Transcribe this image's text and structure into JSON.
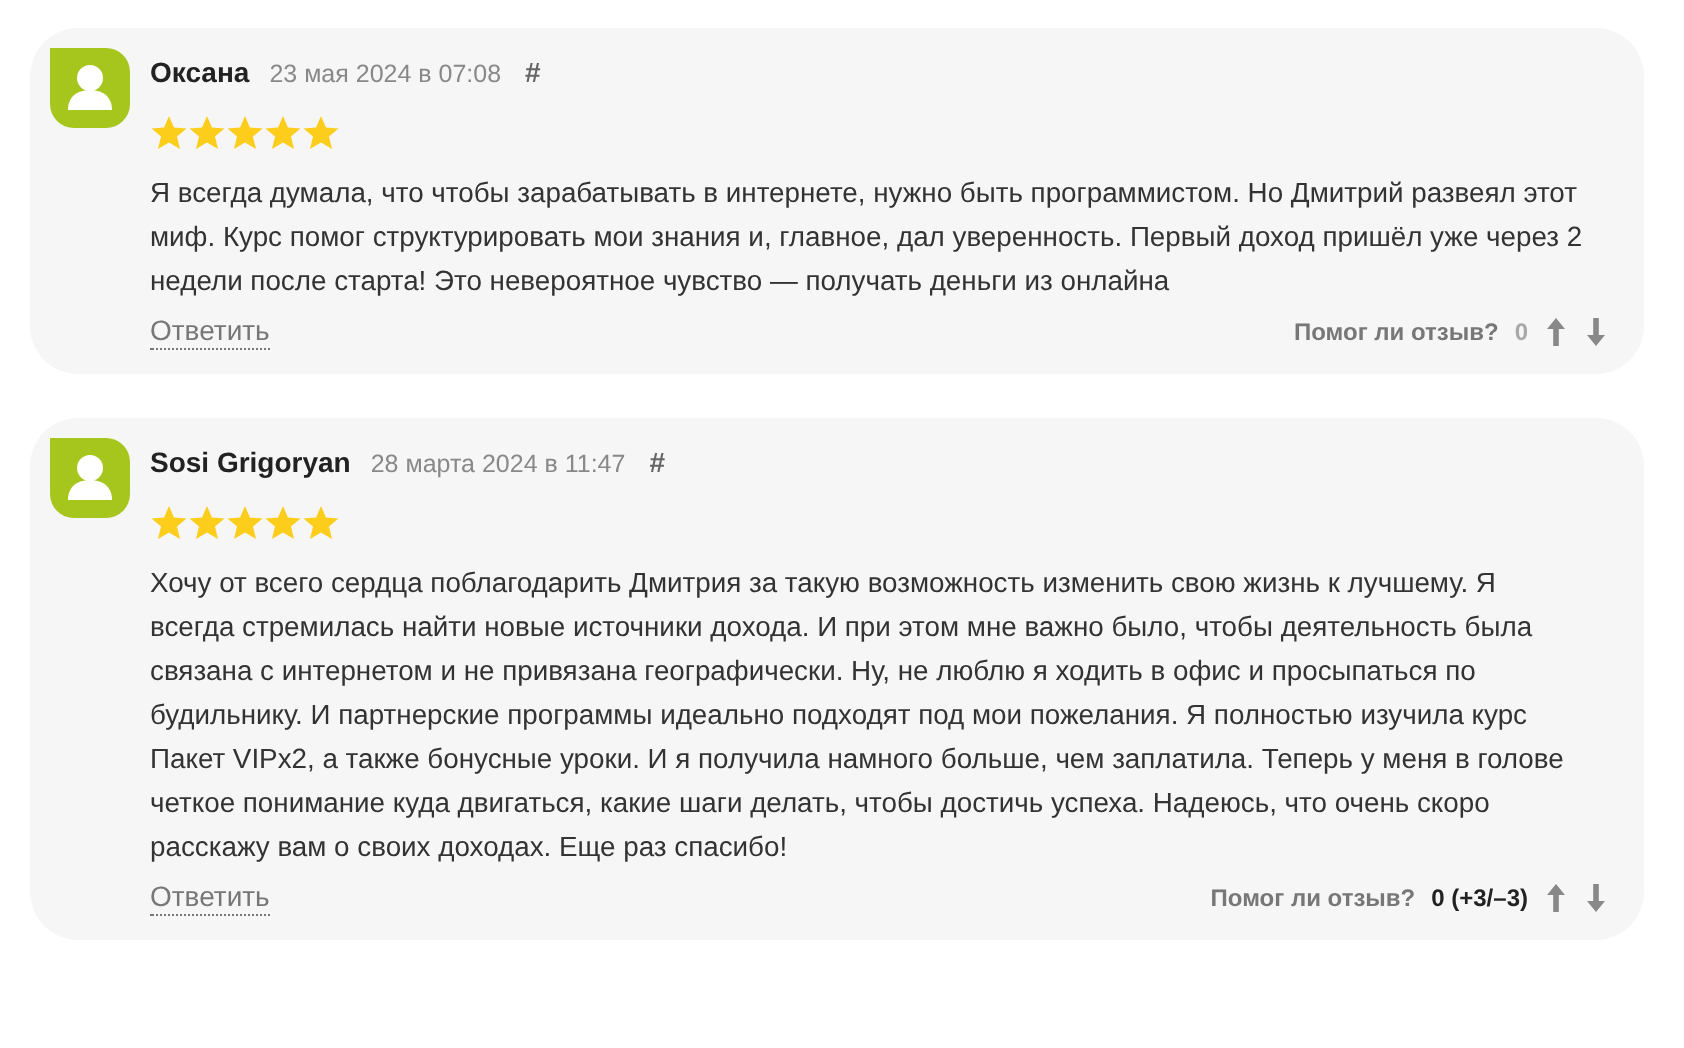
{
  "reviews": [
    {
      "author": "Оксана",
      "date": "23 мая 2024 в 07:08",
      "anchor": "#",
      "stars": 5,
      "text_lines": [
        "Я всегда думала, что чтобы зарабатывать в интернете, нужно быть программистом. Но Дмитрий развеял этот",
        "миф. Курс помог структурировать мои знания и, главное, дал уверенность. Первый доход пришёл уже через 2",
        "недели после старта! Это невероятное чувство — получать деньги из онлайна"
      ],
      "reply": "Ответить",
      "helpful_label": "Помог ли отзыв?",
      "score": "0",
      "score_muted": true
    },
    {
      "author": "Sosi Grigoryan",
      "date": "28 марта 2024 в 11:47",
      "anchor": "#",
      "stars": 5,
      "text_lines": [
        "Хочу от всего сердца поблагодарить Дмитрия за такую возможность изменить свою жизнь к лучшему. Я",
        "всегда стремилась найти новые источники дохода. И при этом мне важно было, чтобы деятельность была",
        "связана с интернетом и не привязана географически. Ну, не люблю я ходить в офис и просыпаться по",
        "будильнику. И партнерские программы идеально подходят под мои пожелания. Я полностью изучила курс",
        "Пакет VIPх2, а также бонусные уроки. И я получила намного больше, чем заплатила. Теперь у меня в голове",
        "четкое понимание куда двигаться, какие шаги делать, чтобы достичь успеха. Надеюсь, что очень скоро",
        "расскажу вам о своих доходах. Еще раз спасибо!"
      ],
      "reply": "Ответить",
      "helpful_label": "Помог ли отзыв?",
      "score": "0 (+3/–3)",
      "score_muted": false
    }
  ]
}
